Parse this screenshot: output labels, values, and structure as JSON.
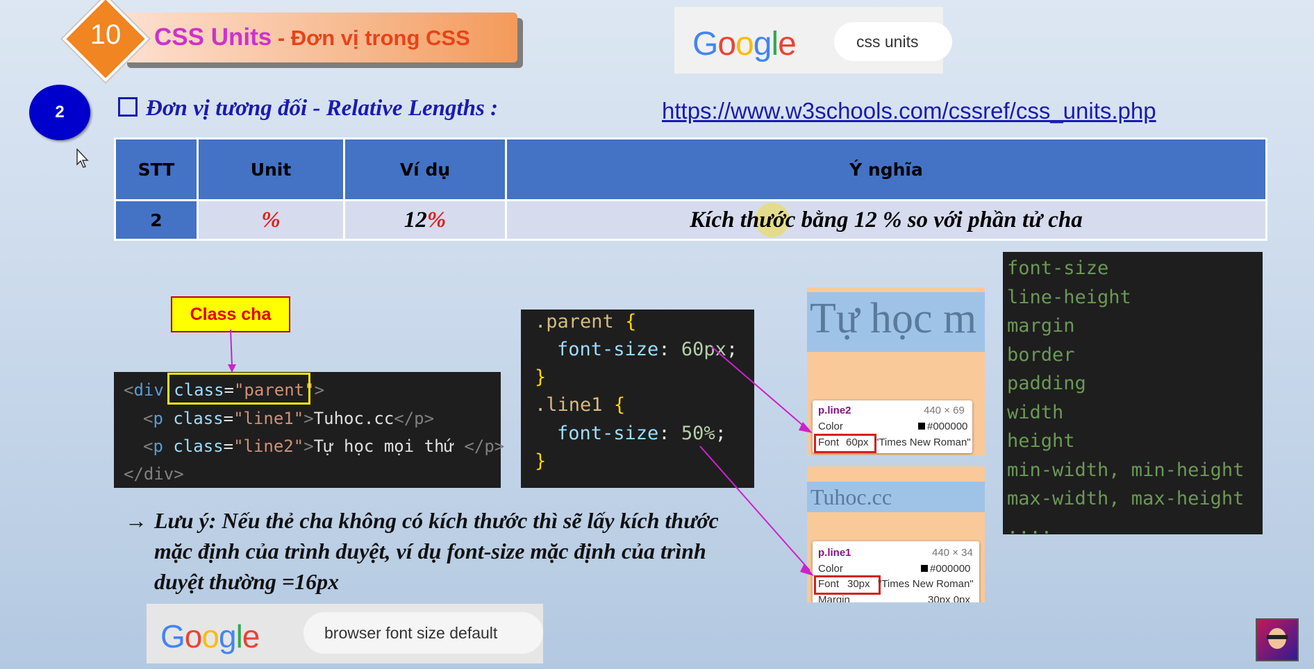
{
  "title": {
    "lesson_number": "10",
    "main": "CSS Units",
    "separator": " - ",
    "sub": "Đơn vị trong CSS"
  },
  "google_top": {
    "logo": "Google",
    "query": "css units"
  },
  "google_bottom": {
    "logo": "Google",
    "query": "browser font size default"
  },
  "section": {
    "step": "2",
    "heading": "Đơn vị tương đối - Relative Lengths :",
    "link": "https://www.w3schools.com/cssref/css_units.php"
  },
  "table": {
    "headers": [
      "STT",
      "Unit",
      "Ví dụ",
      "Ý nghĩa"
    ],
    "row": {
      "stt": "2",
      "unit": "%",
      "example_num": "12",
      "example_unit": "%",
      "meaning": "Kích thước bằng 12 % so với phần tử cha"
    }
  },
  "class_label": "Class cha",
  "html_code": {
    "line1": {
      "open": "<",
      "tag": "div",
      "attr": "class",
      "eq": "=",
      "val": "\"parent\"",
      "close": ">"
    },
    "line2": {
      "tag_open": "<",
      "tag": "p",
      "attr": "class",
      "val": "\"line1\"",
      "text": "Tuhoc.cc",
      "end": "</p>"
    },
    "line3": {
      "tag_open": "<",
      "tag": "p",
      "attr": "class",
      "val": "\"line2\"",
      "text": "Tự học mọi thứ ",
      "end": "</p>"
    },
    "line4": "</div>"
  },
  "css_code": {
    "sel1": ".parent",
    "prop1": "font-size",
    "val1": "60px",
    "sel2": ".line1",
    "prop2": "font-size",
    "val2": "50%"
  },
  "preview_top": {
    "text": "Tự học m",
    "name": "p.line2",
    "size": "440 × 69",
    "color_label": "Color",
    "color_value": "#000000",
    "font_label": "Font",
    "font_size": "60px",
    "font_family": "\"Times New Roman\""
  },
  "preview_bottom": {
    "text": "Tuhoc.cc",
    "name": "p.line1",
    "size": "440 × 34",
    "color_label": "Color",
    "color_value": "#000000",
    "font_label": "Font",
    "font_size": "30px",
    "font_family": "\"Times New Roman\"",
    "margin_label": "Margin",
    "margin_value": "30px 0px"
  },
  "note": [
    "Lưu ý: Nếu thẻ cha không có kích thước thì sẽ lấy kích thước",
    "mặc định của trình duyệt, ví dụ font-size mặc định của trình",
    "duyệt thường =16px"
  ],
  "properties": [
    "font-size",
    "line-height",
    "margin",
    "border",
    "padding",
    "width",
    "height",
    "min-width, min-height",
    "max-width, max-height",
    "...."
  ],
  "colors": {
    "accent_blue": "#4472c4",
    "title_pink": "#cc33cc",
    "red": "#e12020"
  }
}
